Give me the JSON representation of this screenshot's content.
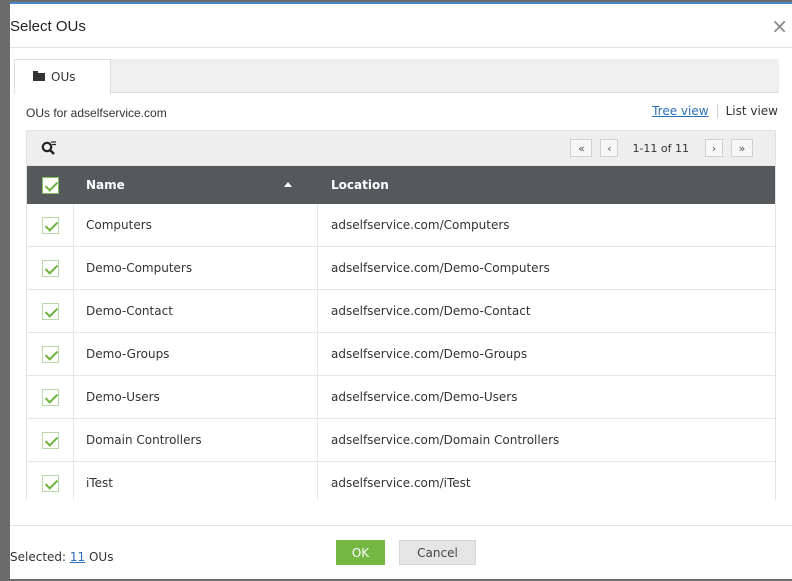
{
  "dialog": {
    "title": "Select OUs",
    "close_glyph": "×"
  },
  "tabs": [
    {
      "label": "OUs",
      "icon": "folder-icon",
      "active": true
    }
  ],
  "panel": {
    "header_label": "OUs for adselfservice.com",
    "tree_view_label": "Tree view",
    "list_view_label": "List view"
  },
  "pager": {
    "first": "«",
    "prev": "‹",
    "text": "1-11 of 11",
    "next": "›",
    "last": "»"
  },
  "grid": {
    "columns": {
      "name": "Name",
      "location": "Location"
    },
    "sort_column": "Name",
    "sort_direction": "ascending",
    "rows": [
      {
        "name": "Computers",
        "location": "adselfservice.com/Computers",
        "checked": true
      },
      {
        "name": "Demo-Computers",
        "location": "adselfservice.com/Demo-Computers",
        "checked": true
      },
      {
        "name": "Demo-Contact",
        "location": "adselfservice.com/Demo-Contact",
        "checked": true
      },
      {
        "name": "Demo-Groups",
        "location": "adselfservice.com/Demo-Groups",
        "checked": true
      },
      {
        "name": "Demo-Users",
        "location": "adselfservice.com/Demo-Users",
        "checked": true
      },
      {
        "name": "Domain Controllers",
        "location": "adselfservice.com/Domain Controllers",
        "checked": true
      },
      {
        "name": "iTest",
        "location": "adselfservice.com/iTest",
        "checked": true
      }
    ]
  },
  "footer": {
    "selected_prefix": "Selected: ",
    "selected_count": "11",
    "selected_suffix": " OUs",
    "ok_label": "OK",
    "cancel_label": "Cancel"
  },
  "colors": {
    "accent": "#4a86c8",
    "header_bg": "#55595c",
    "ok_green": "#74b843",
    "check_green": "#6cb33e",
    "link_blue": "#2a6ebb"
  }
}
